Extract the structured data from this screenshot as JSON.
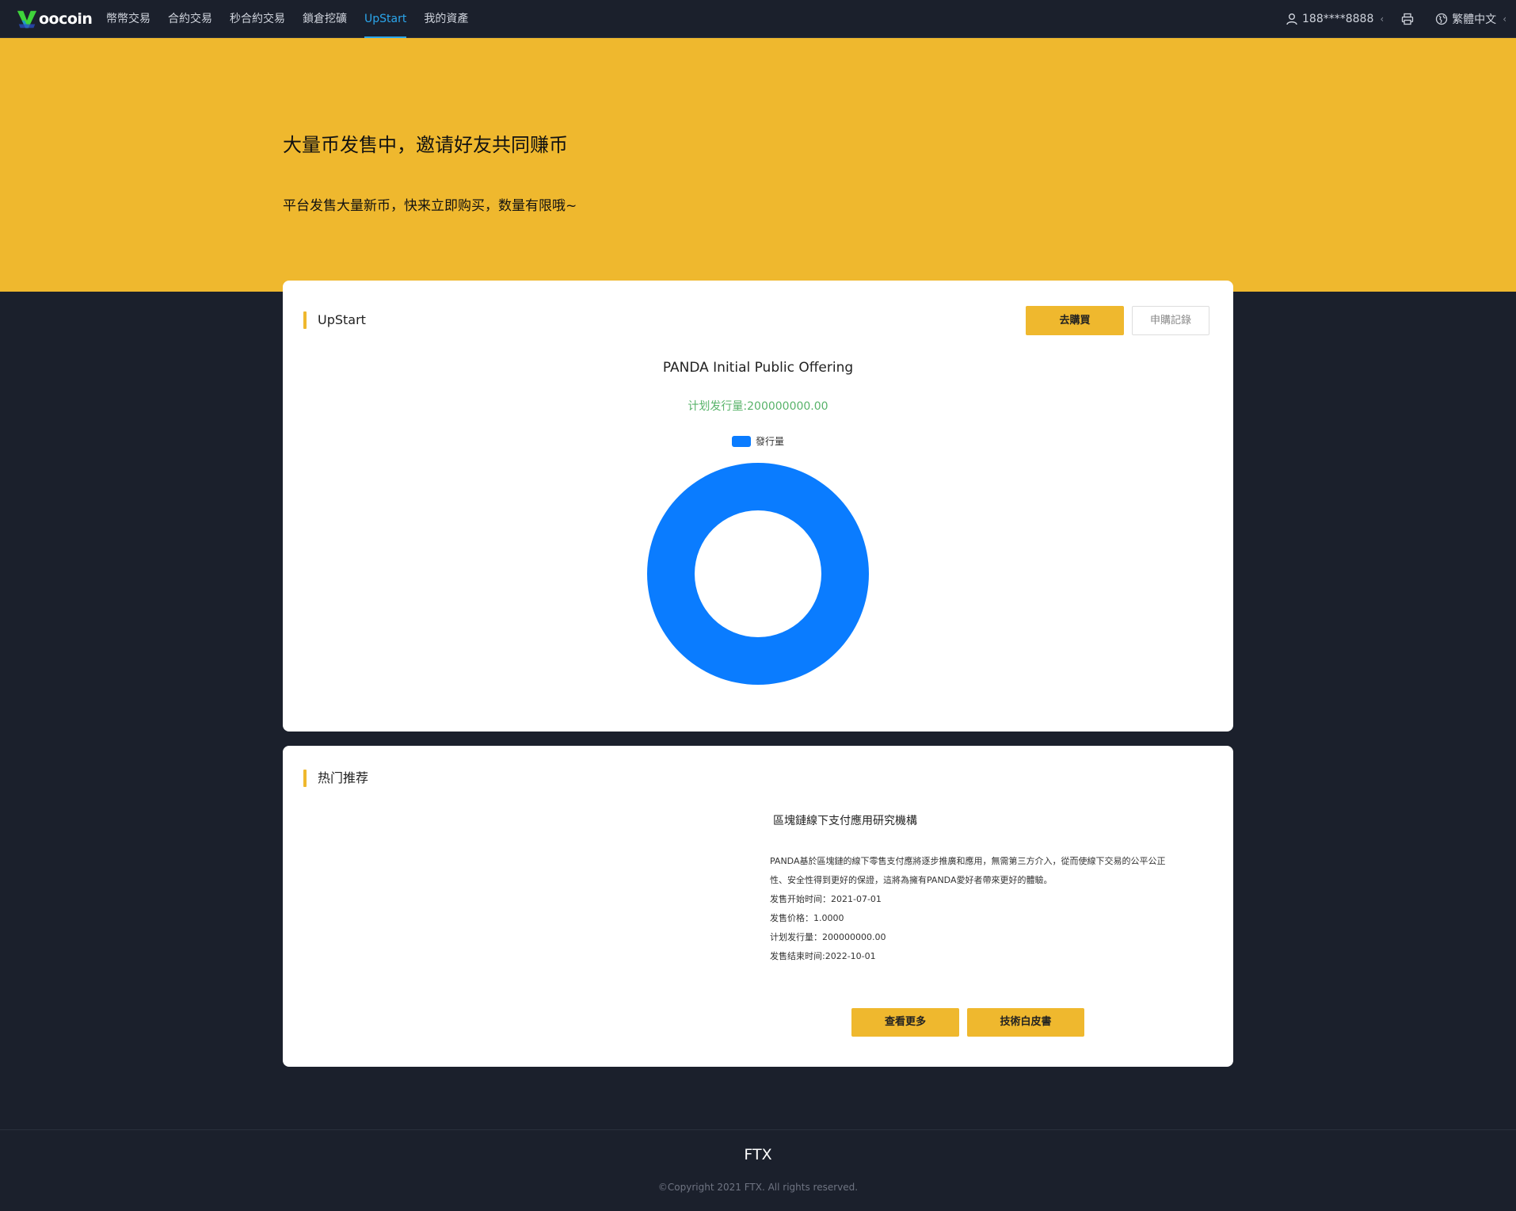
{
  "nav": {
    "logo_text": "oocoin",
    "items": [
      {
        "label": "幣幣交易",
        "active": false
      },
      {
        "label": "合約交易",
        "active": false
      },
      {
        "label": "秒合約交易",
        "active": false
      },
      {
        "label": "鎖倉挖礦",
        "active": false
      },
      {
        "label": "UpStart",
        "active": true
      },
      {
        "label": "我的資產",
        "active": false
      }
    ],
    "user_phone": "188****8888",
    "user_chevron": "‹",
    "language": "繁體中文",
    "language_chevron": "‹"
  },
  "hero": {
    "title": "大量币发售中，邀请好友共同赚币",
    "subtitle": "平台发售大量新币，快来立即购买，数量有限哦~"
  },
  "upstart": {
    "title": "UpStart",
    "buy_button": "去購買",
    "records_button": "申購記錄"
  },
  "chart_data": {
    "type": "pie",
    "title": "PANDA Initial Public Offering",
    "subtitle": "计划发行量:200000000.00",
    "series": [
      {
        "name": "發行量",
        "values": [
          200000000.0
        ]
      }
    ],
    "donut": true,
    "legend_position": "top"
  },
  "recommend": {
    "title": "热门推荐",
    "org_title": "區塊鏈線下支付應用研究機構",
    "description": "PANDA基於區塊鏈的線下零售支付應將逐步推廣和應用，無需第三方介入，從而使線下交易的公平公正性、安全性得到更好的保證，這將為擁有PANDA愛好者帶來更好的體驗。",
    "start_time": "发售开始时间：2021-07-01",
    "price": "发售价格：1.0000",
    "planned_amount": "计划发行量：200000000.00",
    "end_time": "发售结束时间:2022-10-01",
    "more_button": "查看更多",
    "whitepaper_button": "技術白皮書"
  },
  "footer": {
    "brand": "FTX",
    "copyright": "©Copyright 2021 FTX. All rights reserved."
  },
  "colors": {
    "accent": "#efb82e",
    "nav_active": "#2ba6ec",
    "chart_blue": "#0a7cff",
    "green_text": "#58b36a",
    "background": "#1b202c"
  }
}
